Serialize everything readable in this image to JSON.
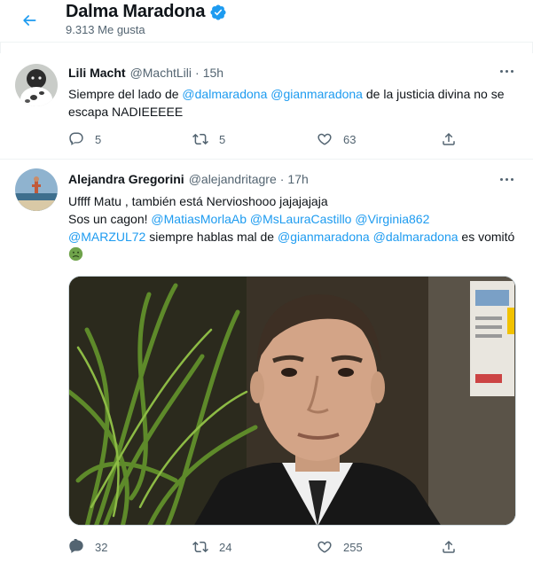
{
  "header": {
    "name": "Dalma Maradona",
    "likes_label": "9.313 Me gusta"
  },
  "colors": {
    "accent": "#1d9bf0",
    "secondary_text": "#536471",
    "border": "#eff3f4"
  },
  "tweets": [
    {
      "name": "Lili Macht",
      "handle": "@MachtLili",
      "time": "15h",
      "text_segments": [
        {
          "text": "Siempre del lado de ",
          "type": "text"
        },
        {
          "text": "@dalmaradona",
          "type": "mention"
        },
        {
          "text": " ",
          "type": "text"
        },
        {
          "text": "@gianmaradona",
          "type": "mention"
        },
        {
          "text": " de la justicia divina no se escapa NADIEEEEE",
          "type": "text"
        }
      ],
      "replies": "5",
      "retweets": "5",
      "likes": "63"
    },
    {
      "name": "Alejandra Gregorini",
      "handle": "@alejandritagre",
      "time": "17h",
      "line1": "Uffff Matu , también está Nervioshooo jajajajaja",
      "line2_prefix": "Sos un cagon! ",
      "mentions": [
        "@MatiasMorlaAb",
        "@MsLauraCastillo",
        "@Virginia862",
        "@MARZUL72",
        "@gianmaradona",
        "@dalmaradona"
      ],
      "mid_text": " siempre hablas mal de ",
      "end_text": " es vomitó",
      "emoji": "nauseated-face-icon",
      "replies": "32",
      "retweets": "24",
      "likes": "255"
    }
  ]
}
